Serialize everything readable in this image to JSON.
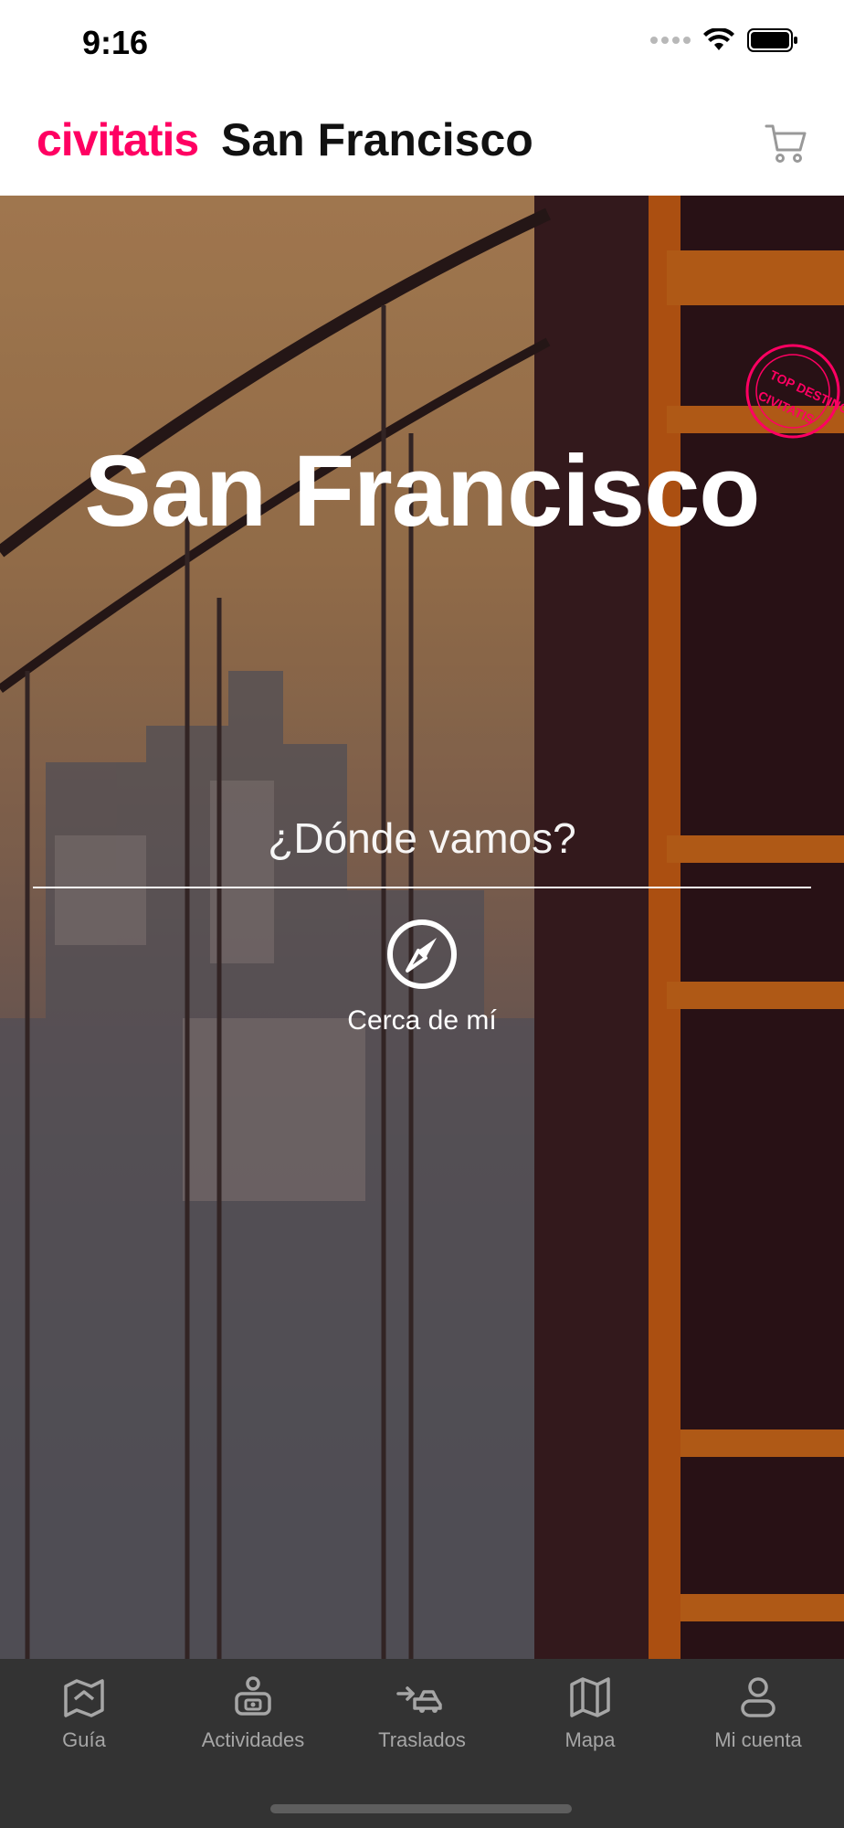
{
  "status_bar": {
    "time": "9:16"
  },
  "header": {
    "brand": "civitatis",
    "city": "San Francisco",
    "cart_icon": "cart-icon"
  },
  "hero": {
    "title": "San Francisco",
    "stamp_text": "TOP DESTINOS CIVITATIS",
    "search_placeholder": "¿Dónde vamos?",
    "near_me_label": "Cerca de mí"
  },
  "tabs": [
    {
      "label": "Guía",
      "icon": "map-guide-icon"
    },
    {
      "label": "Actividades",
      "icon": "activities-icon"
    },
    {
      "label": "Traslados",
      "icon": "transfers-icon"
    },
    {
      "label": "Mapa",
      "icon": "map-icon"
    },
    {
      "label": "Mi cuenta",
      "icon": "account-icon"
    }
  ],
  "colors": {
    "brand": "#ff0062",
    "tab_inactive": "#a6a6a6",
    "tab_bar": "#333333"
  }
}
